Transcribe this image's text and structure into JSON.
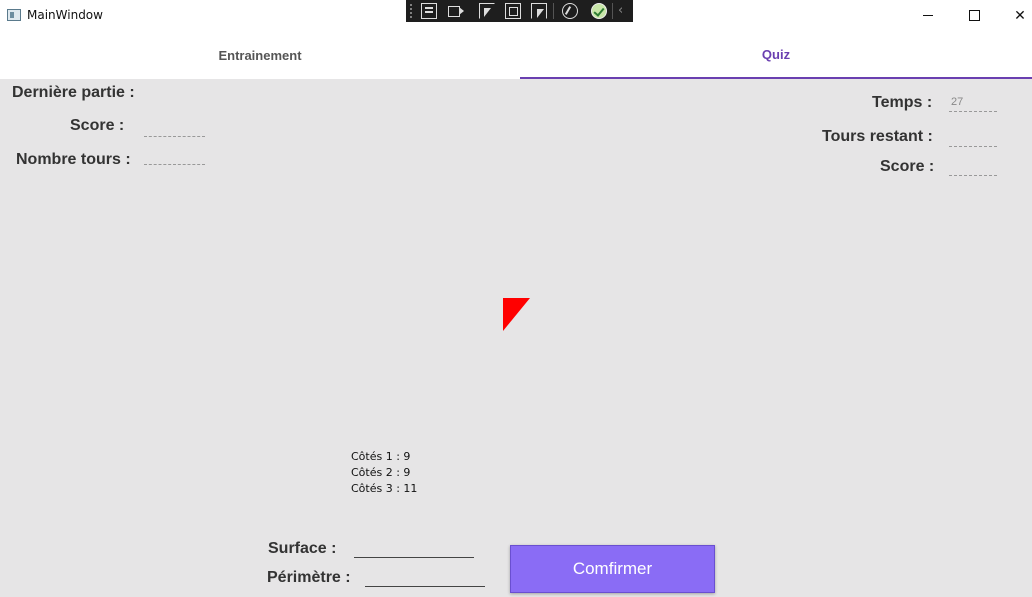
{
  "window": {
    "title": "MainWindow",
    "min_icon": "minimize-icon",
    "max_icon": "maximize-icon",
    "close_symbol": "✕"
  },
  "debug_toolbar": {
    "icons": [
      "grip-icon",
      "live-tree-icon",
      "record-icon",
      "select-element-icon",
      "display-layout-adorners-icon",
      "track-focus-icon",
      "hot-reload-icon",
      "binding-check-icon",
      "collapse-icon"
    ],
    "collapse_symbol": "‹"
  },
  "tabs": [
    {
      "label": "Entrainement",
      "selected": false
    },
    {
      "label": "Quiz",
      "selected": true
    }
  ],
  "left_panel": {
    "last_game_label": "Dernière partie :",
    "score_label": "Score :",
    "score_value": "",
    "rounds_label": "Nombre tours :",
    "rounds_value": ""
  },
  "right_panel": {
    "time_label": "Temps :",
    "time_value": "27",
    "remaining_label": "Tours restant :",
    "remaining_value": "",
    "score_label": "Score :",
    "score_value": ""
  },
  "shape": {
    "type": "triangle",
    "color": "#ff0000"
  },
  "sides": {
    "side1": "Côtés 1 : 9",
    "side2": "Côtés 2 : 9",
    "side3": "Côtés 3 : 11"
  },
  "answer": {
    "surface_label": "Surface :",
    "surface_value": "",
    "perimeter_label": "Périmètre :",
    "perimeter_value": ""
  },
  "confirm_button": {
    "label": "Comfirmer",
    "color": "#8a6cf5"
  },
  "colors": {
    "accent": "#6a3fb0",
    "content_bg": "#e6e5e6"
  }
}
